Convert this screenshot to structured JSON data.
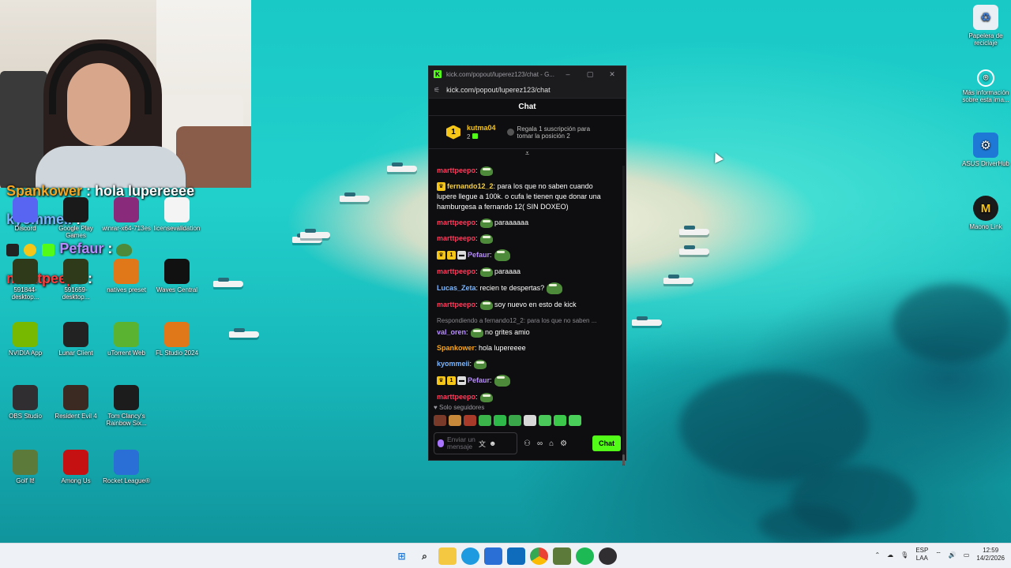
{
  "overlay_chat": [
    {
      "name": "Spankower",
      "text": " : hola lupereeee",
      "color": "#f6a623"
    },
    {
      "name": "kyommeii",
      "text": " :",
      "color": "#7ab6ff"
    },
    {
      "name": "Pefaur",
      "text": " :",
      "color": "#b88cff"
    },
    {
      "name": "marttpeepo",
      "text": " :",
      "color": "#ff3b3b"
    }
  ],
  "desktop_icons": [
    {
      "label": "Discord",
      "icon": "discord-icon",
      "color": "#5865f2"
    },
    {
      "label": "Google Play Games",
      "icon": "google-play-icon",
      "color": "#1a1a1a"
    },
    {
      "label": "winrar-x64-713es",
      "icon": "winrar-icon",
      "color": "#8a2a7a"
    },
    {
      "label": "licensevalidation",
      "icon": "document-icon",
      "color": "#f4f4f4"
    },
    {
      "label": "591844-desktop...",
      "icon": "nvidia-shortcut-icon",
      "color": "#2f3a1a"
    },
    {
      "label": "591659-desktop...",
      "icon": "nvidia-shortcut-icon",
      "color": "#2f3a1a"
    },
    {
      "label": "natives preset",
      "icon": "fl-preset-icon",
      "color": "#e0781a"
    },
    {
      "label": "Waves Central",
      "icon": "waves-icon",
      "color": "#111111"
    },
    {
      "label": "NVIDIA App",
      "icon": "nvidia-icon",
      "color": "#76b900"
    },
    {
      "label": "Lunar Client",
      "icon": "lunar-icon",
      "color": "#222222"
    },
    {
      "label": "uTorrent Web",
      "icon": "utorrent-icon",
      "color": "#5bb332"
    },
    {
      "label": "FL Studio 2024",
      "icon": "fl-studio-icon",
      "color": "#e0781a"
    },
    {
      "label": "OBS Studio",
      "icon": "obs-icon",
      "color": "#302e31"
    },
    {
      "label": "Resident Evil 4",
      "icon": "re4-icon",
      "color": "#3a2a22"
    },
    {
      "label": "Tom Clancy's Rainbow Six...",
      "icon": "r6-icon",
      "color": "#1c1c1c"
    },
    {
      "label": "Golf It!",
      "icon": "golf-it-icon",
      "color": "#5c7a3a"
    },
    {
      "label": "Among Us",
      "icon": "among-us-icon",
      "color": "#c51111"
    },
    {
      "label": "Rocket League®",
      "icon": "rocket-league-icon",
      "color": "#2a6fd6"
    }
  ],
  "right_icons": [
    {
      "label": "Papelera de reciclaje",
      "icon": "recycle-bin-icon"
    },
    {
      "label": "Más información sobre esta ima...",
      "icon": "spotlight-info-icon"
    },
    {
      "label": "ASUS DriverHub",
      "icon": "asus-driverhub-icon"
    },
    {
      "label": "Maono Link",
      "icon": "maono-link-icon"
    }
  ],
  "window": {
    "title": "kick.com/popout/luperez123/chat - G...",
    "minimize": "–",
    "maximize": "▢",
    "close": "✕",
    "url": "kick.com/popout/luperez123/chat"
  },
  "chat": {
    "header": "Chat",
    "pinned": {
      "rank": "1",
      "name": "kutma04",
      "count": "2",
      "cta": "Regala 1 suscripción para tomar la posición 2"
    },
    "messages": [
      {
        "name": "marttpeepo",
        "color": "#ff3b5c",
        "text": "",
        "emote": true,
        "badges": []
      },
      {
        "name": "fernando12_2",
        "color": "#f6d043",
        "text": " para los que no saben cuando lupere llegue a 100k. o cufa le tienen que donar una hamburgesa a fernando 12( SIN DOXEO)",
        "emote": false,
        "badges": [
          "crown"
        ]
      },
      {
        "name": "marttpeepo",
        "color": "#ff3b5c",
        "text": " paraaaaaa",
        "emote": true,
        "badges": []
      },
      {
        "name": "marttpeepo",
        "color": "#ff3b5c",
        "text": "",
        "emote": true,
        "badges": []
      },
      {
        "name": "Pefaur",
        "color": "#b88cff",
        "text": "",
        "emote": true,
        "big": true,
        "badges": [
          "crown",
          "rank",
          "glasses"
        ]
      },
      {
        "name": "marttpeepo",
        "color": "#ff3b5c",
        "text": " paraaaa",
        "emote": true,
        "badges": []
      },
      {
        "name": "Lucas_Zeta",
        "color": "#7ab6ff",
        "text": " recien te despertas?",
        "emote": true,
        "big": true,
        "emote_after": true,
        "badges": []
      },
      {
        "name": "marttpeepo",
        "color": "#ff3b5c",
        "text": " soy nuevo en esto de kick",
        "emote": true,
        "badges": []
      },
      {
        "reply": "Respondiendo a fernando12_2: para los que no saben ...",
        "name": "val_oren",
        "color": "#b88cff",
        "text": " no grites amio",
        "emote": true,
        "badges": []
      },
      {
        "name": "Spankower",
        "color": "#f6a623",
        "text": " hola lupereeee",
        "emote": false,
        "badges": []
      },
      {
        "name": "kyommeii",
        "color": "#7ab6ff",
        "text": "",
        "emote": true,
        "badges": []
      },
      {
        "name": "Pefaur",
        "color": "#b88cff",
        "text": "",
        "emote": true,
        "big": true,
        "badges": [
          "crown",
          "rank",
          "glasses"
        ]
      },
      {
        "name": "marttpeepo",
        "color": "#ff3b5c",
        "text": "",
        "emote": true,
        "badges": []
      }
    ],
    "followers_only": "Solo seguidores",
    "input_placeholder": "Enviar un mensaje",
    "send_label": "Chat"
  },
  "taskbar": {
    "apps": [
      "start-icon",
      "search-icon",
      "file-explorer-icon",
      "edge-icon",
      "app-store-icon",
      "outlook-icon",
      "chrome-icon",
      "golf-it-taskbar-icon",
      "spotify-icon",
      "obs-taskbar-icon"
    ],
    "lang_top": "ESP",
    "lang_bottom": "LAA",
    "time": "12:59",
    "date": "14/2/2026"
  },
  "colors": {
    "kick_green": "#53fc18",
    "chat_bg": "#0e0e10"
  }
}
